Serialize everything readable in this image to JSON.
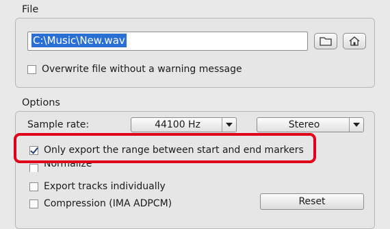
{
  "file_group": {
    "title": "File",
    "path_value": "C:\\Music\\New.wav",
    "overwrite_label": "Overwrite file without a warning message",
    "overwrite_checked": false
  },
  "options_group": {
    "title": "Options",
    "sample_rate_label": "Sample rate:",
    "sample_rate_value": "44100 Hz",
    "channels_value": "Stereo",
    "only_export_label": "Only export the range between start and end markers",
    "only_export_checked": true,
    "normalize_label": "Normalize",
    "normalize_checked": false,
    "export_tracks_label": "Export tracks individually",
    "export_tracks_checked": false,
    "compression_label": "Compression (IMA ADPCM)",
    "compression_checked": false,
    "reset_label": "Reset"
  },
  "icons": {
    "browse": "folder-icon",
    "home": "home-icon"
  },
  "colors": {
    "highlight": "#e0001a",
    "selection": "#2a6fd3"
  }
}
